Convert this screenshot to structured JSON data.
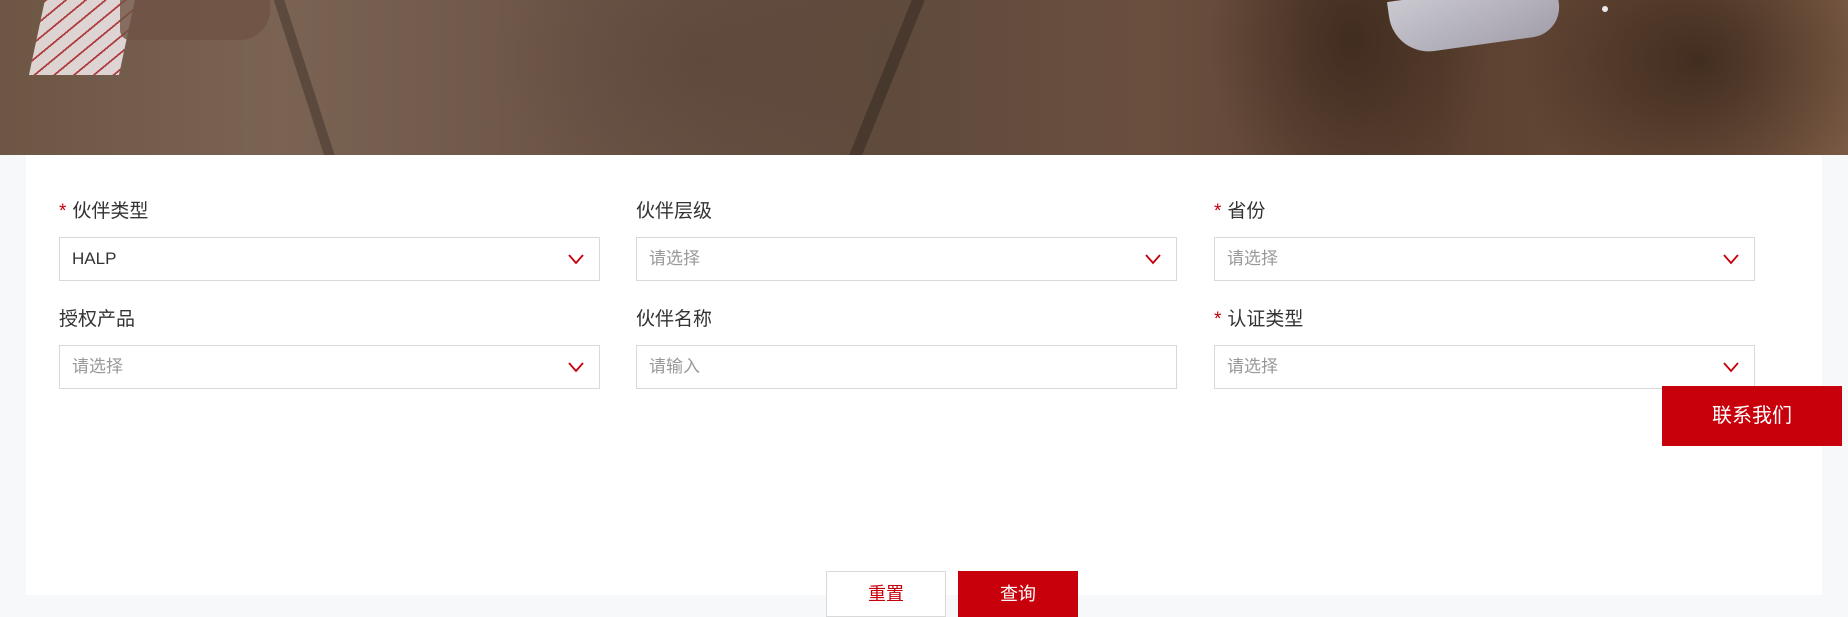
{
  "form": {
    "partner_type": {
      "label": "伙伴类型",
      "required": true,
      "value": "HALP"
    },
    "partner_level": {
      "label": "伙伴层级",
      "required": false,
      "placeholder": "请选择"
    },
    "province": {
      "label": "省份",
      "required": true,
      "placeholder": "请选择"
    },
    "authorized_product": {
      "label": "授权产品",
      "required": false,
      "placeholder": "请选择"
    },
    "partner_name": {
      "label": "伙伴名称",
      "required": false,
      "placeholder": "请输入"
    },
    "certification_type": {
      "label": "认证类型",
      "required": true,
      "placeholder": "请选择"
    },
    "required_mark": "*",
    "chevron_icon": "chevron-down-icon"
  },
  "buttons": {
    "reset_label": "重置",
    "query_label": "查询"
  },
  "contact": {
    "label": "联系我们"
  },
  "colors": {
    "accent": "#c7000b",
    "border": "#d9d9d9",
    "placeholder": "#999999",
    "text": "#333333"
  }
}
